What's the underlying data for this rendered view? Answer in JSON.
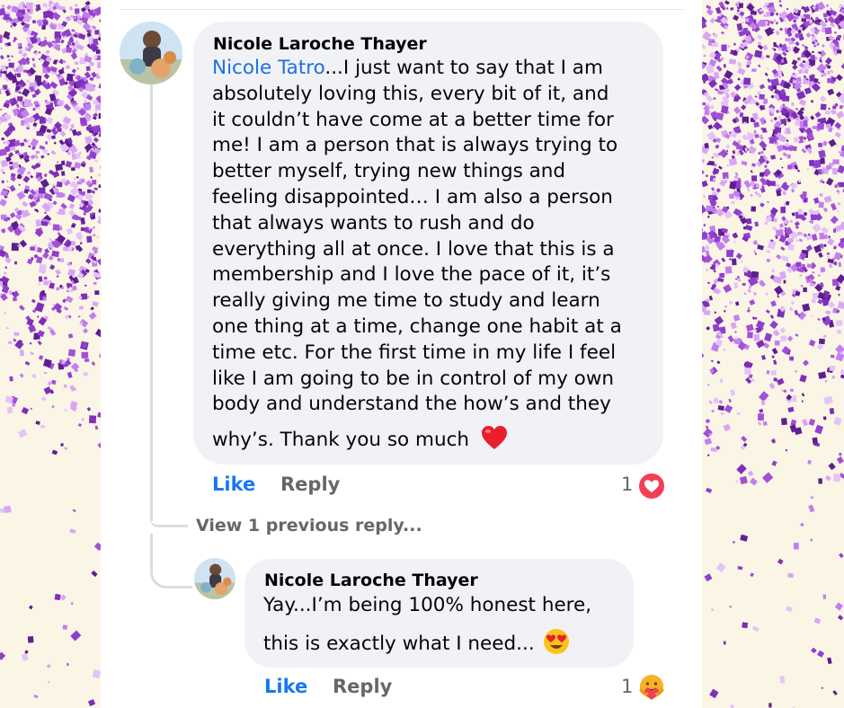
{
  "colors": {
    "like_blue": "#1877f2",
    "mention_blue": "#216fdb",
    "muted_gray": "#65676b",
    "bubble_bg": "#f0f2f5",
    "glitter_purple": "#a34fd6",
    "page_cream": "#fbf5e6"
  },
  "comments": {
    "first": {
      "author": "Nicole Laroche Thayer",
      "mention": "Nicole Tatro",
      "lines": [
        "...I just want to say that I am",
        "absolutely loving this, every bit of it, and",
        "it couldn’t have come at a better time for",
        "me! I am a person that is always trying to",
        "better myself, trying new things and",
        "feeling disappointed… I am also a person",
        "that always wants to rush and do",
        "everything all at once. I love that this is a",
        "membership and I love the pace of it, it’s",
        "really giving me time to study and learn",
        "one thing at a time, change one habit at a",
        "time etc. For the first time in my life I feel",
        "like I am going to be in control of my own",
        "body and understand the how’s and they",
        "why’s. Thank you so much"
      ],
      "emoji": "red-heart-emoji",
      "like_label": "Like",
      "reply_label": "Reply",
      "reaction_count": "1",
      "reaction_icon": "love-reaction-icon"
    },
    "view_previous_label": "View 1 previous reply...",
    "second": {
      "author": "Nicole Laroche Thayer",
      "lines": [
        "Yay...I’m being 100% honest here,",
        "this is exactly what I need..."
      ],
      "emoji": "heart-eyes-emoji",
      "like_label": "Like",
      "reply_label": "Reply",
      "reaction_count": "1",
      "reaction_icon": "care-reaction-icon"
    }
  }
}
